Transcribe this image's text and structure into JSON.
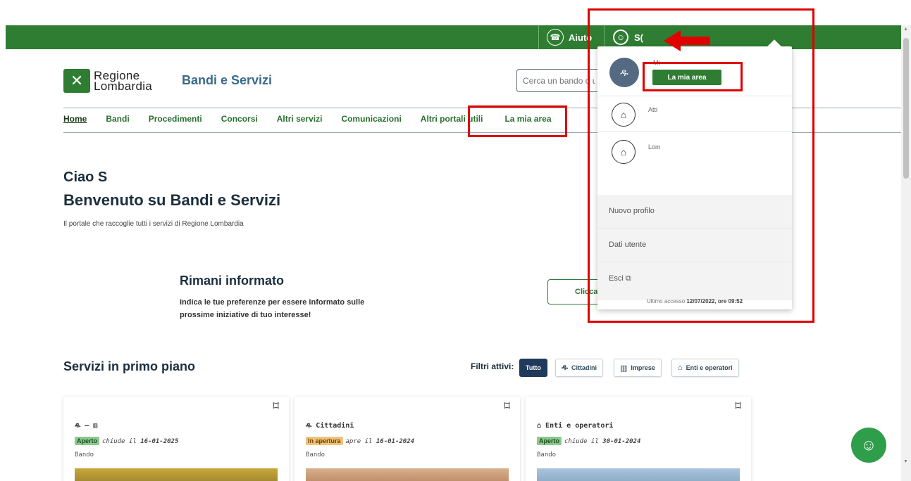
{
  "topbar": {
    "help_label": "Aiuto",
    "user_label": "S("
  },
  "header": {
    "logo_line1": "Regione",
    "logo_line2": "Lombardia",
    "site_title": "Bandi e Servizi",
    "search_placeholder": "Cerca un bando o un"
  },
  "nav": {
    "items": [
      {
        "label": "Home"
      },
      {
        "label": "Bandi"
      },
      {
        "label": "Procedimenti"
      },
      {
        "label": "Concorsi"
      },
      {
        "label": "Altri servizi"
      },
      {
        "label": "Comunicazioni"
      },
      {
        "label": "Altri portali utili"
      },
      {
        "label": "La mia area"
      }
    ]
  },
  "greeting": {
    "hello": "Ciao S",
    "welcome": "Benvenuto su Bandi e Servizi",
    "subtitle": "Il portale che raccoglie tutti i servizi di Regione Lombardia"
  },
  "info": {
    "title": "Rimani informato",
    "text": "Indica le tue preferenze per essere informato sulle prossime iniziative di tuo interesse!",
    "cta_label": "Clicca q"
  },
  "services": {
    "title": "Servizi in primo piano",
    "filters_label": "Filtri attivi:",
    "filters": [
      "Tutto",
      "Cittadini",
      "Imprese",
      "Enti e operatori"
    ],
    "cards": [
      {
        "target": "— ",
        "badge": "Aperto",
        "status_text": "chiude il",
        "date": "16-01-2025",
        "type": "Bando"
      },
      {
        "target": "Cittadini",
        "badge": "In apertura",
        "status_text": "apre il",
        "date": "16-01-2024",
        "type": "Bando"
      },
      {
        "target": "Enti e operatori",
        "badge": "Aperto",
        "status_text": "chiude il",
        "date": "30-01-2024",
        "type": "Bando"
      }
    ]
  },
  "dropdown": {
    "mi_label": "Mi",
    "my_area_button": "La mia area",
    "profiles": [
      {
        "label": "Atti"
      },
      {
        "label": "Lom"
      }
    ],
    "new_profile": "Nuovo profilo",
    "user_data": "Dati utente",
    "logout": "Esci",
    "last_access_prefix": "Ultimo accesso",
    "last_access_value": "12/07/2022, ore 09:52"
  },
  "colors": {
    "brand_green": "#2e7d32",
    "annotation_red": "#e00000",
    "navy": "#1b2e3e"
  }
}
